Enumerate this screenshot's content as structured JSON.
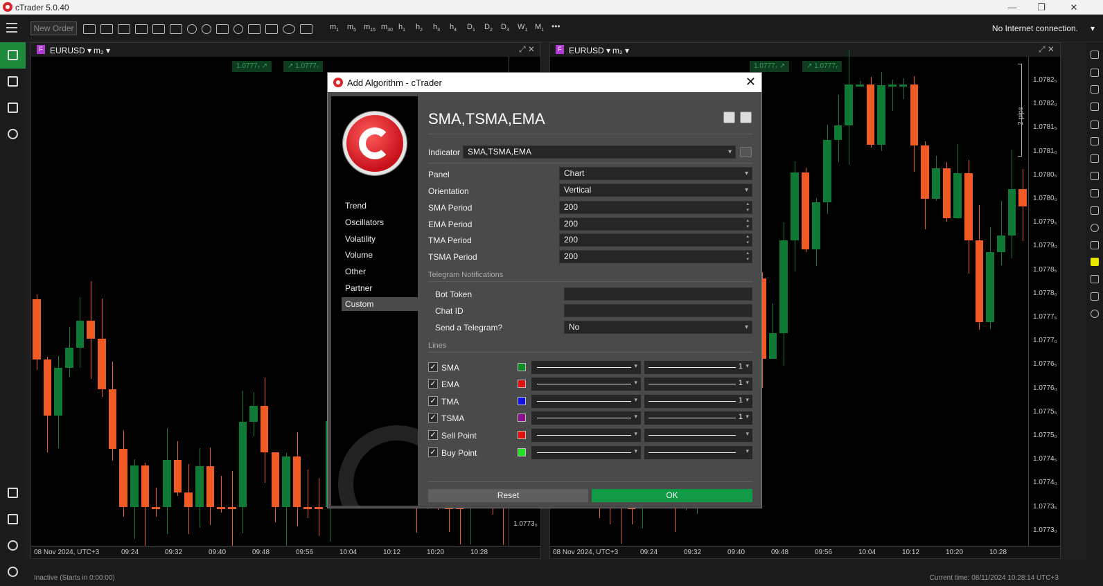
{
  "window": {
    "title": "cTrader 5.0.40",
    "min": "—",
    "max": "❐",
    "close": "✕"
  },
  "toolbar": {
    "new_order": "New Order",
    "timeframes": [
      {
        "label": "m",
        "sub": "1"
      },
      {
        "label": "m",
        "sub": "5"
      },
      {
        "label": "m",
        "sub": "15"
      },
      {
        "label": "m",
        "sub": "30"
      },
      {
        "label": "h",
        "sub": "1"
      },
      {
        "label": "h",
        "sub": "2"
      },
      {
        "label": "h",
        "sub": "3"
      },
      {
        "label": "h",
        "sub": "4"
      },
      {
        "label": "D",
        "sub": "1"
      },
      {
        "label": "D",
        "sub": "2"
      },
      {
        "label": "D",
        "sub": "3"
      },
      {
        "label": "W",
        "sub": "1"
      },
      {
        "label": "M",
        "sub": "1"
      }
    ],
    "more": "•••",
    "connection": "No Internet connection.",
    "connection_arrow": "▾"
  },
  "charts": [
    {
      "badge": "F",
      "symbol": "EURUSD ▾",
      "timeframe": "m₂ ▾",
      "price_sell": "1.0777₇",
      "price_buy": "1.0777₇",
      "date": "08 Nov 2024, UTC+3",
      "times": [
        "09:24",
        "09:32",
        "09:40",
        "09:48",
        "09:56",
        "10:04",
        "10:12",
        "10:20",
        "10:28"
      ],
      "last_price": "1.0773₀"
    },
    {
      "badge": "F",
      "symbol": "EURUSD ▾",
      "timeframe": "m₂ ▾",
      "price_sell": "1.0777₇",
      "price_buy": "1.0777₇",
      "date": "08 Nov 2024, UTC+3",
      "times": [
        "09:24",
        "09:32",
        "09:40",
        "09:48",
        "09:56",
        "10:04",
        "10:12",
        "10:20",
        "10:28"
      ],
      "pips": "2 pips",
      "prices": [
        "1.0782₅",
        "1.0782₀",
        "1.0781₅",
        "1.0781₀",
        "1.0780₅",
        "1.0780₀",
        "1.0779₅",
        "1.0779₀",
        "1.0778₅",
        "1.0778₀",
        "1.0777₅",
        "1.0777₀",
        "1.0776₅",
        "1.0776₀",
        "1.0775₅",
        "1.0775₀",
        "1.0774₅",
        "1.0774₀",
        "1.0773₅",
        "1.0773₀"
      ]
    }
  ],
  "status": {
    "left": "Inactive (Starts in 0:00:00)",
    "right": "Current time: 08/11/2024 10:28:14  UTC+3"
  },
  "dialog": {
    "title": "Add Algorithm - cTrader",
    "categories": [
      "Trend",
      "Oscillators",
      "Volatility",
      "Volume",
      "Other",
      "Partner",
      "Custom"
    ],
    "algo_name": "SMA,TSMA,EMA",
    "indicator_label": "Indicator",
    "indicator_value": "SMA,TSMA,EMA",
    "params": [
      {
        "label": "Panel",
        "value": "Chart",
        "type": "dd"
      },
      {
        "label": "Orientation",
        "value": "Vertical",
        "type": "dd"
      },
      {
        "label": "SMA Period",
        "value": "200",
        "type": "spin"
      },
      {
        "label": "EMA Period",
        "value": "200",
        "type": "spin"
      },
      {
        "label": "TMA Period",
        "value": "200",
        "type": "spin"
      },
      {
        "label": "TSMA Period",
        "value": "200",
        "type": "spin"
      }
    ],
    "telegram_section": "Telegram Notifications",
    "telegram": [
      {
        "label": "Bot Token",
        "value": "",
        "type": "text"
      },
      {
        "label": "Chat ID",
        "value": "",
        "type": "text"
      },
      {
        "label": "Send a Telegram?",
        "value": "No",
        "type": "dd"
      }
    ],
    "lines_section": "Lines",
    "lines": [
      {
        "name": "SMA",
        "color": "#0c8a28",
        "width": "1"
      },
      {
        "name": "EMA",
        "color": "#e01010",
        "width": "1"
      },
      {
        "name": "TMA",
        "color": "#1010e0",
        "width": "1"
      },
      {
        "name": "TSMA",
        "color": "#8a1090",
        "width": "1"
      },
      {
        "name": "Sell Point",
        "color": "#e01010",
        "width": ""
      },
      {
        "name": "Buy Point",
        "color": "#22e022",
        "width": ""
      }
    ],
    "check": "✓",
    "reset": "Reset",
    "ok": "OK"
  }
}
